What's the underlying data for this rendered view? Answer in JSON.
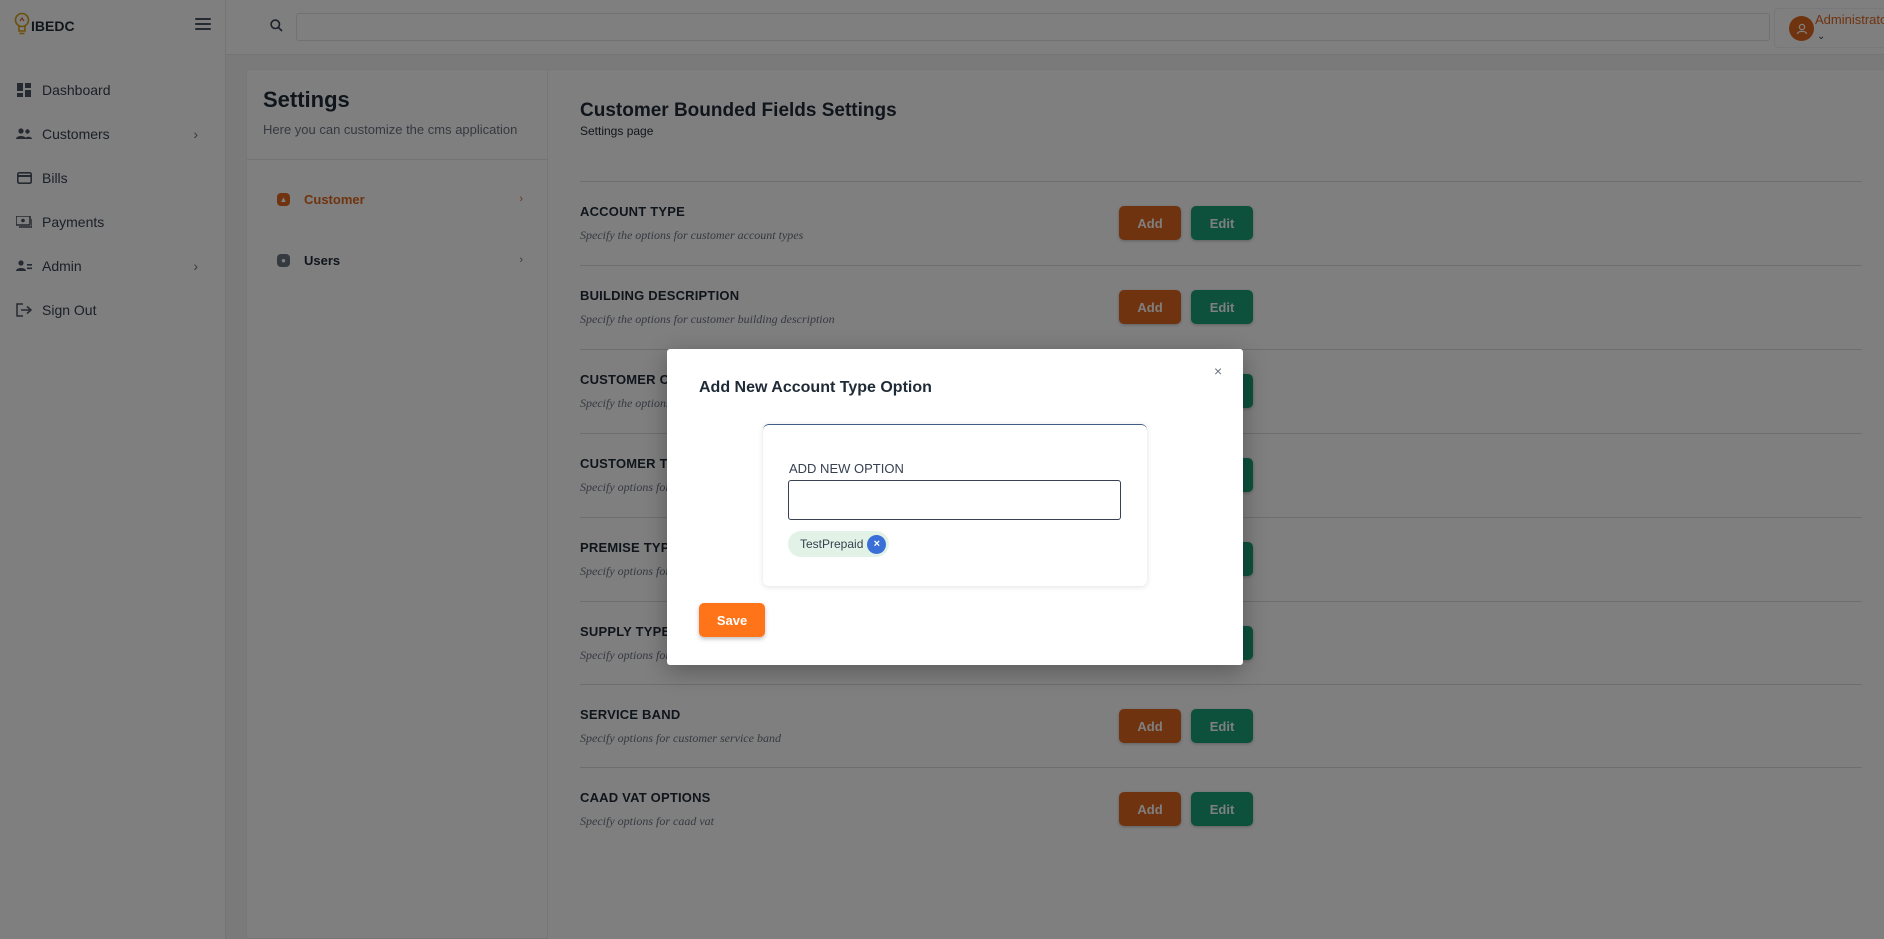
{
  "brand": {
    "name": "IBEDC",
    "icon": "lightbulb-icon"
  },
  "sidebar": {
    "items": [
      {
        "label": "Dashboard",
        "icon": "dashboard-icon",
        "has_submenu": false
      },
      {
        "label": "Customers",
        "icon": "customers-icon",
        "has_submenu": true
      },
      {
        "label": "Bills",
        "icon": "bills-icon",
        "has_submenu": false
      },
      {
        "label": "Payments",
        "icon": "payments-icon",
        "has_submenu": false
      },
      {
        "label": "Admin",
        "icon": "admin-icon",
        "has_submenu": true
      },
      {
        "label": "Sign Out",
        "icon": "sign-out-icon",
        "has_submenu": false
      }
    ]
  },
  "topbar": {
    "search_placeholder": "",
    "user_name": "Administrator"
  },
  "settings": {
    "title": "Settings",
    "subtitle": "Here you can customize the cms application",
    "nav": [
      {
        "label": "Customer",
        "active": true
      },
      {
        "label": "Users",
        "active": false
      }
    ]
  },
  "main": {
    "title": "Customer Bounded Fields Settings",
    "subtitle": "Settings page",
    "add_label": "Add",
    "edit_label": "Edit",
    "rows": [
      {
        "title": "ACCOUNT TYPE",
        "description": "Specify the options for customer account types"
      },
      {
        "title": "BUILDING DESCRIPTION",
        "description": "Specify the options for customer building description"
      },
      {
        "title": "CUSTOMER CATEGORY",
        "description": "Specify the options for customer category"
      },
      {
        "title": "CUSTOMER TYPE",
        "description": "Specify options for customer type"
      },
      {
        "title": "PREMISE TYPE",
        "description": "Specify options for premise type"
      },
      {
        "title": "SUPPLY TYPE",
        "description": "Specify options for supply type"
      },
      {
        "title": "SERVICE BAND",
        "description": "Specify options for customer service band"
      },
      {
        "title": "CAAD VAT OPTIONS",
        "description": "Specify options for caad vat"
      }
    ]
  },
  "modal": {
    "title": "Add New Account Type Option",
    "close_label": "×",
    "field_label": "ADD NEW OPTION",
    "field_value": "",
    "tags": [
      {
        "label": "TestPrepaid",
        "remove_label": "×"
      }
    ],
    "save_label": "Save"
  },
  "colors": {
    "accent_orange": "#e0671f",
    "save_orange": "#ff7419",
    "edit_green": "#1aa37a",
    "tag_remove_blue": "#3b6fd8"
  }
}
